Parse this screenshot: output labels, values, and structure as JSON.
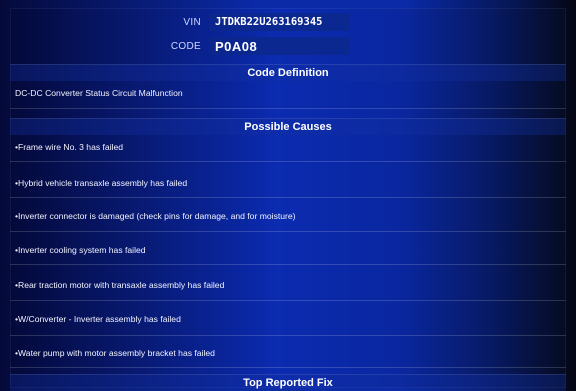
{
  "vin": {
    "label": "VIN",
    "value": "JTDKB22U263169345"
  },
  "code": {
    "label": "CODE",
    "value": "P0A08"
  },
  "definition": {
    "title": "Code Definition",
    "text": "DC-DC Converter Status Circuit Malfunction"
  },
  "causes": {
    "title": "Possible Causes",
    "items": [
      "•Frame wire No. 3 has failed",
      "•Hybrid vehicle transaxle assembly has failed",
      "•Inverter connector is damaged (check pins for damage, and for moisture)",
      "•Inverter cooling system has failed",
      "•Rear traction motor with transaxle assembly has failed",
      "•W/Converter - Inverter assembly has failed",
      "•Water pump with motor assembly bracket has failed"
    ]
  },
  "top_fix": {
    "title": "Top Reported Fix"
  }
}
